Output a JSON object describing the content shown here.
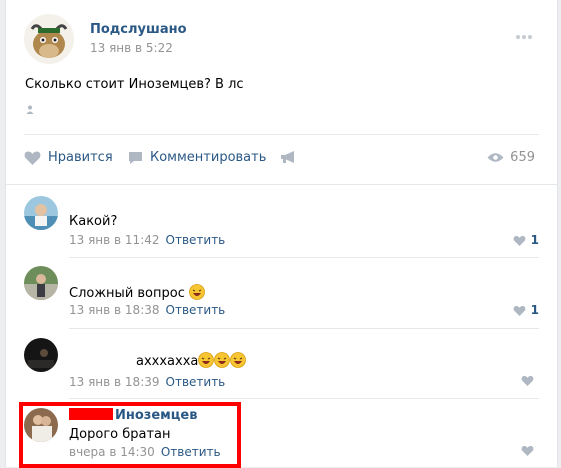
{
  "post": {
    "author": "Подслушано",
    "date": "13 янв в 5:22",
    "text": "Сколько стоит Иноземцев? В лс",
    "actions": {
      "like_label": "Нравится",
      "comment_label": "Комментировать",
      "views_count": "659"
    }
  },
  "comments": [
    {
      "text": "Какой?",
      "date": "13 янв в 11:42",
      "reply_label": "Ответить",
      "likes": "1"
    },
    {
      "text": "Сложный вопрос",
      "date": "13 янв в 18:38",
      "reply_label": "Ответить",
      "likes": "1"
    },
    {
      "text": "ахххахха",
      "date": "13 янв в 18:39",
      "reply_label": "Ответить",
      "likes": ""
    },
    {
      "name": "Иноземцев",
      "text": "Дорого братан",
      "date": "вчера в 14:30",
      "reply_label": "Ответить",
      "likes": ""
    }
  ],
  "colors": {
    "link": "#2a5885",
    "meta": "#939393",
    "highlight": "#ff0000"
  }
}
